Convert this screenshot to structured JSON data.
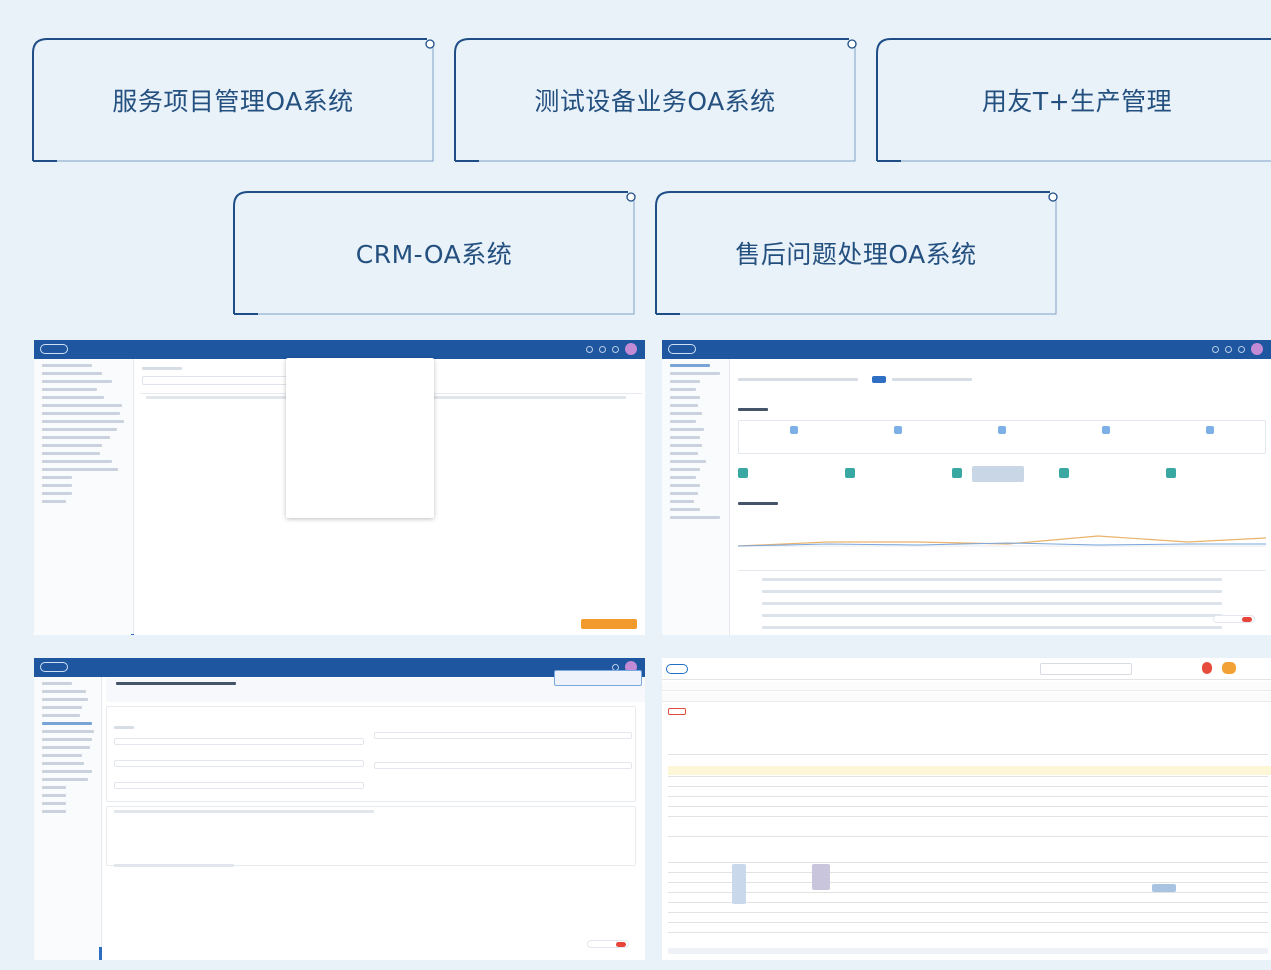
{
  "cards": [
    {
      "label": "服务项目管理OA系统"
    },
    {
      "label": "测试设备业务OA系统"
    },
    {
      "label": "用友T+生产管理"
    },
    {
      "label": "CRM-OA系统"
    },
    {
      "label": "售后问题处理OA系统"
    }
  ],
  "colors": {
    "background": "#e9f1f9",
    "card_border": "#1f4e86",
    "card_text": "#24507f",
    "app_header": "#1e56a0"
  },
  "screenshots": [
    {
      "name": "oa-service-project-screenshot"
    },
    {
      "name": "oa-dashboard-screenshot"
    },
    {
      "name": "oa-approval-form-screenshot"
    },
    {
      "name": "yonyou-tplus-production-screenshot"
    }
  ]
}
